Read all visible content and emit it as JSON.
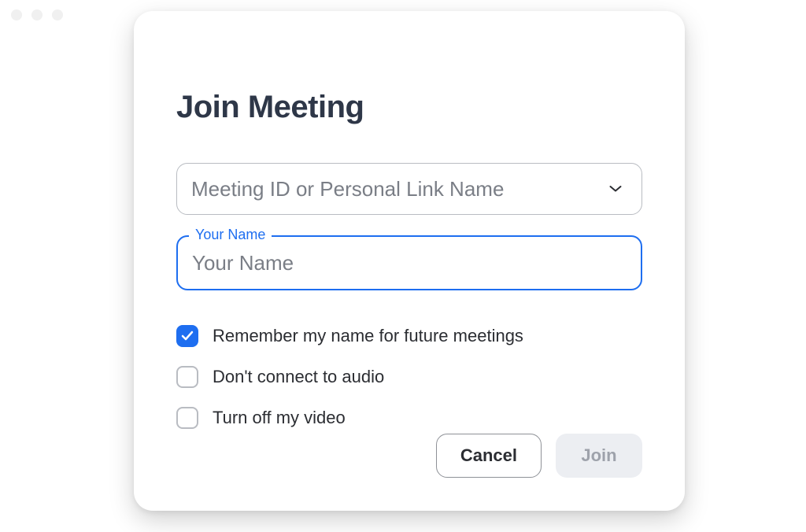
{
  "dialog": {
    "title": "Join Meeting",
    "meeting_id": {
      "placeholder": "Meeting ID or Personal Link Name"
    },
    "name_field": {
      "label": "Your Name",
      "placeholder": "Your Name",
      "value": ""
    },
    "checkboxes": {
      "remember_name": {
        "label": "Remember my name for future meetings",
        "checked": true
      },
      "no_audio": {
        "label": "Don't connect to audio",
        "checked": false
      },
      "no_video": {
        "label": "Turn off my video",
        "checked": false
      }
    },
    "buttons": {
      "cancel": "Cancel",
      "join": "Join"
    }
  },
  "colors": {
    "accent": "#1e6ef0",
    "title": "#2e3748",
    "placeholder": "#7a7e86",
    "border": "#b9bcc2",
    "disabled_bg": "#eceef2",
    "disabled_text": "#9ea2ab"
  }
}
